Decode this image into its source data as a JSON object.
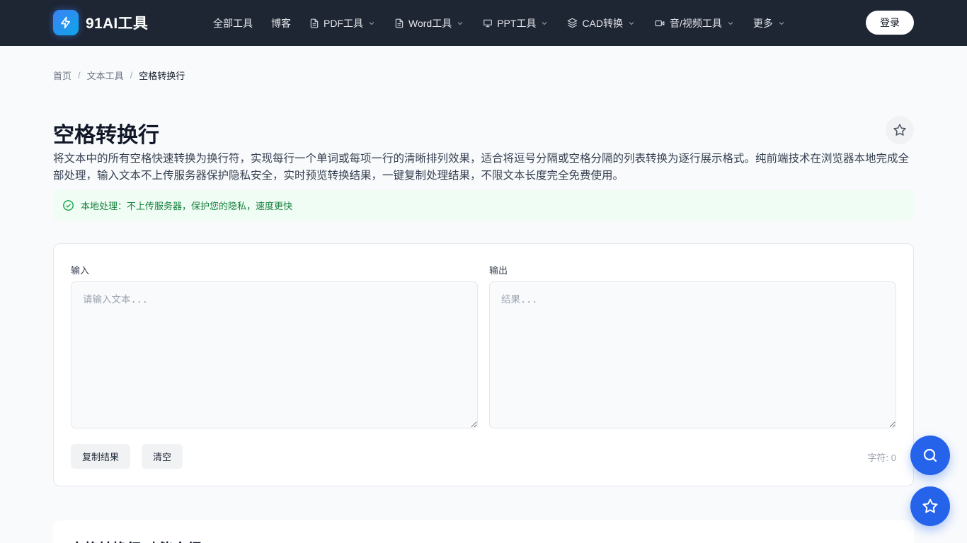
{
  "header": {
    "brand": "91AI工具",
    "nav": [
      {
        "label": "全部工具"
      },
      {
        "label": "博客"
      },
      {
        "label": "PDF工具"
      },
      {
        "label": "Word工具"
      },
      {
        "label": "PPT工具"
      },
      {
        "label": "CAD转换"
      },
      {
        "label": "音/视频工具"
      },
      {
        "label": "更多"
      }
    ],
    "login_label": "登录"
  },
  "breadcrumb": {
    "home": "首页",
    "category": "文本工具",
    "current": "空格转换行",
    "separator": "/"
  },
  "page": {
    "title": "空格转换行",
    "description": "将文本中的所有空格快速转换为换行符，实现每行一个单词或每项一行的清晰排列效果，适合将逗号分隔或空格分隔的列表转换为逐行展示格式。纯前端技术在浏览器本地完成全部处理，输入文本不上传服务器保护隐私安全，实时预览转换结果，一键复制处理结果，不限文本长度完全免费使用。",
    "local_note": "本地处理：不上传服务器，保护您的隐私，速度更快"
  },
  "tool": {
    "input_label": "输入",
    "input_placeholder": "请输入文本...",
    "input_value": "",
    "output_label": "输出",
    "output_placeholder": "结果...",
    "output_value": "",
    "copy_label": "复制结果",
    "clear_label": "清空",
    "char_count_label": "字符: 0"
  },
  "section2": {
    "title": "空格转换行 功能介绍"
  },
  "colors": {
    "header_bg": "#1e2533",
    "accent": "#2563eb",
    "success": "#15803d"
  },
  "icons": {
    "logo": "lightning-icon",
    "fav": "star-outline-icon",
    "search_fab": "search-icon",
    "fav_fab": "star-icon"
  }
}
